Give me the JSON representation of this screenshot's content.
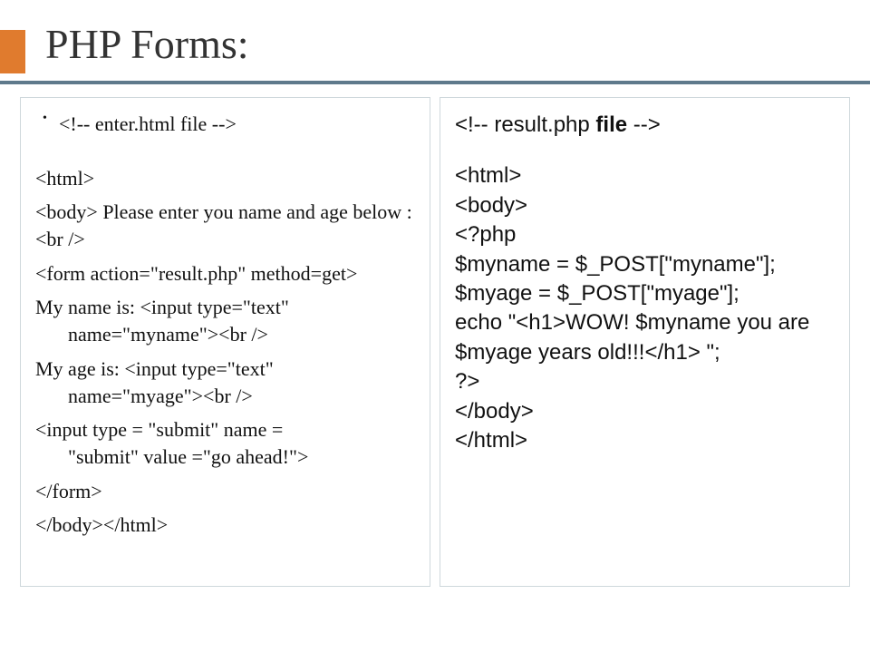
{
  "title": "PHP Forms:",
  "left": {
    "l0": "<!-- enter.html file -->",
    "l1": "<html>",
    "l2": "<body>    Please enter you name and age below : <br />",
    "l3": "<form action=\"result.php\" method=get>",
    "l4a": "My name is:   <input type=\"text\"",
    "l4b": "name=\"myname\"><br />",
    "l5a": " My age is:  <input type=\"text\"",
    "l5b": "name=\"myage\"><br />",
    "l6a": "<input type = \"submit\" name =",
    "l6b": "\"submit\" value =\"go ahead!\">",
    "l7": "</form>",
    "l8": "</body></html>"
  },
  "right": {
    "r0a": "<!-- result.php ",
    "r0b": "file",
    "r0c": " -->",
    "r1": "<html>",
    "r2": "<body>",
    "r3": "<?php",
    "r4": "$myname = $_POST[\"myname\"];",
    "r5": "$myage = $_POST[\"myage\"];",
    "r6a": "echo \"",
    "r6b": "<h1>WOW! $myname you are $myage years old!!!</h1>",
    "r6c": " \";",
    "r7": "?>",
    "r8": "</body>",
    "r9": "</html>"
  }
}
